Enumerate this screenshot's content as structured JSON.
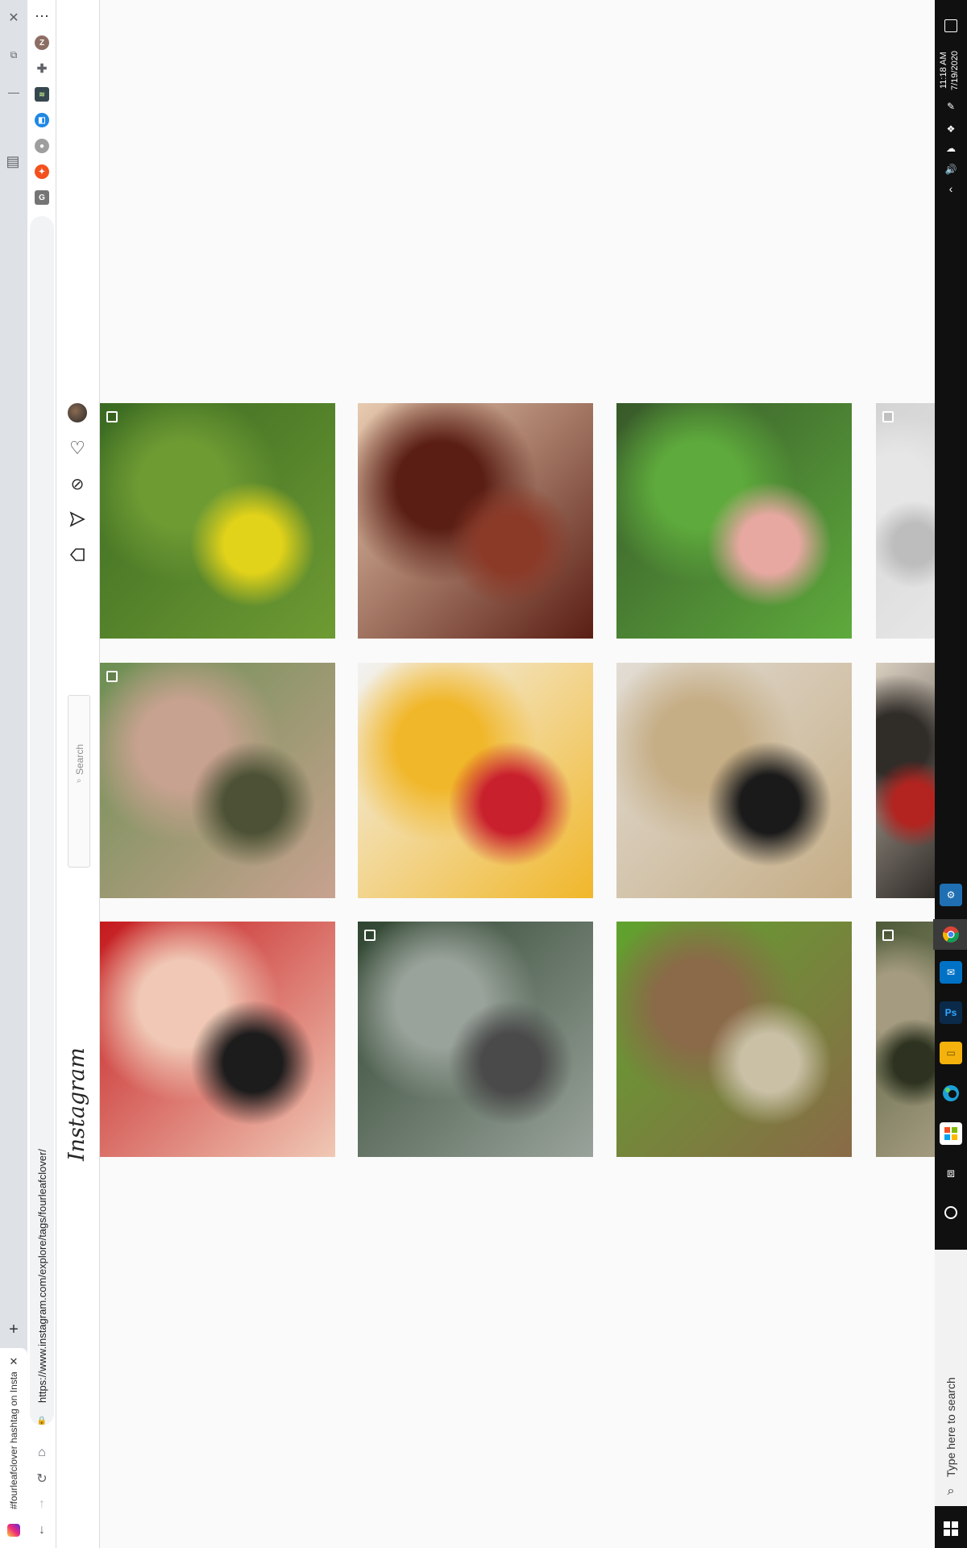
{
  "browser": {
    "tab_title": "#fourleafclover hashtag on Insta...",
    "url": "https://www.instagram.com/explore/tags/fourleafclover/",
    "profile_initial": "Z",
    "new_tab_label": "+",
    "more_label": "⋯"
  },
  "instagram": {
    "logo": "Instagram",
    "search_placeholder": "Search"
  },
  "grid": {
    "rows": [
      [
        {
          "name": "buttercup-meadow",
          "colors": [
            "#3a6a22",
            "#6f9b33",
            "#e1d21a"
          ]
        },
        {
          "name": "brown-haircut",
          "colors": [
            "#e8cbb0",
            "#5a1e14",
            "#8c3a28"
          ]
        },
        {
          "name": "four-leaf-clover-hand",
          "colors": [
            "#38592a",
            "#5eaa3c",
            "#e8a8a2"
          ]
        },
        {
          "name": "partial-grey",
          "colors": [
            "#d4d4d4",
            "#e6e6e6",
            "#bdbdbd"
          ]
        }
      ],
      [
        {
          "name": "boy-with-mask-clover",
          "colors": [
            "#6b8f52",
            "#c8a290",
            "#4d5236"
          ]
        },
        {
          "name": "daisy-bouquet",
          "colors": [
            "#f2f2f2",
            "#f1b72a",
            "#c9202e"
          ]
        },
        {
          "name": "pampas-grass-vase",
          "colors": [
            "#e2ddd5",
            "#c5ad85",
            "#1a1a1a"
          ]
        },
        {
          "name": "partial-sign-number",
          "colors": [
            "#d9cfc0",
            "#302c28",
            "#b3231f"
          ]
        }
      ],
      [
        {
          "name": "hands-with-clover-plaid",
          "colors": [
            "#c4191d",
            "#f0c8b5",
            "#1c1c1c"
          ]
        },
        {
          "name": "cabin-camper-forest",
          "colors": [
            "#2f4530",
            "#9aa39b",
            "#4a4a4a"
          ]
        },
        {
          "name": "clover-coins-collage",
          "colors": [
            "#5fa32d",
            "#8a6a48",
            "#c9c0a6"
          ]
        },
        {
          "name": "partial-forest-ground",
          "colors": [
            "#4d5a38",
            "#a49b80",
            "#2d3320"
          ]
        }
      ]
    ]
  },
  "taskbar": {
    "time": "11:18 AM",
    "date": "7/19/2020",
    "search_placeholder": "Type here to search"
  },
  "colors": {
    "accent_instagram": "#c13584",
    "taskbar_bg": "#101010",
    "page_bg": "#fafafa"
  }
}
